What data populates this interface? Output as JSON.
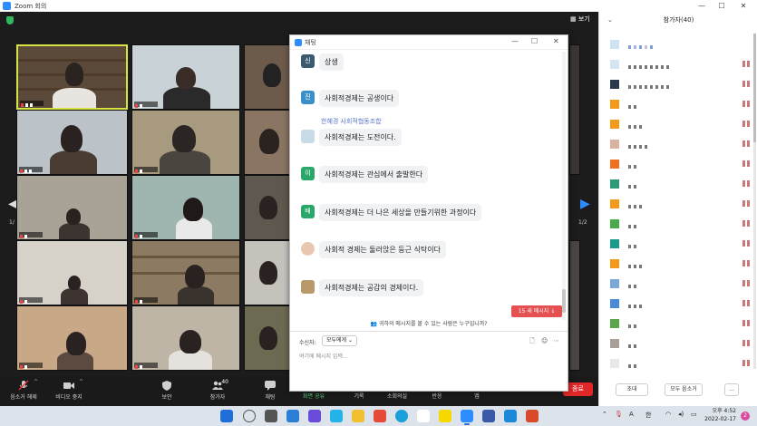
{
  "window": {
    "title": "Zoom 회의",
    "view_label": "보기",
    "left_page": "1/",
    "right_page": "1/2"
  },
  "toolbar": {
    "mute_label": "음소거 해제",
    "video_label": "비디오 중지",
    "security_label": "보안",
    "participants_label": "참가자",
    "participants_count": "40",
    "chat_label": "채팅",
    "share_label": "화면 공유",
    "record_label": "기록",
    "breakout_label": "소회의실",
    "reactions_label": "반응",
    "apps_label": "앱",
    "end_label": "종료"
  },
  "participants": {
    "header": "참가자(40)",
    "invite_label": "초대",
    "mute_all_label": "모두 음소거",
    "more_label": "..."
  },
  "chat": {
    "title": "채팅",
    "messages": [
      {
        "avatar": "신",
        "text": "상생"
      },
      {
        "avatar": "진",
        "text": "사회적경제는 공생이다"
      },
      {
        "avatar": "",
        "text": "사회적경제는 도전이다."
      },
      {
        "avatar": "이",
        "text": "사회적경제는 관심에서 출발한다"
      },
      {
        "avatar": "배",
        "text": "사회적경제는 더 나은 세상을 만들기위한 과정이다"
      },
      {
        "avatar": "",
        "text": "사회적 경제는 둘러앉은 둥근 식탁이다"
      },
      {
        "avatar": "",
        "text": "사회적경제는 공감의 경제이다."
      }
    ],
    "ghost_sender": "한혜경 사회적협동조합",
    "new_messages_label": "15 새 메시지 ↓",
    "who_can_see": "귀하의 메시지를 볼 수 있는 사람은 누구입니까?",
    "to_label": "수신자:",
    "to_value": "모두에게",
    "input_placeholder": "여기에 메시지 입력..."
  },
  "taskbar": {
    "time_line1": "오후 4:52",
    "time_line2": "2022-02-17",
    "notification_count": "2",
    "ime_label": "A",
    "lang_label": "한"
  },
  "colors": {
    "zoom_blue": "#2d8cff",
    "end_red": "#e02828",
    "speaker_border": "#d6e343",
    "new_msg_red": "#e55050"
  }
}
